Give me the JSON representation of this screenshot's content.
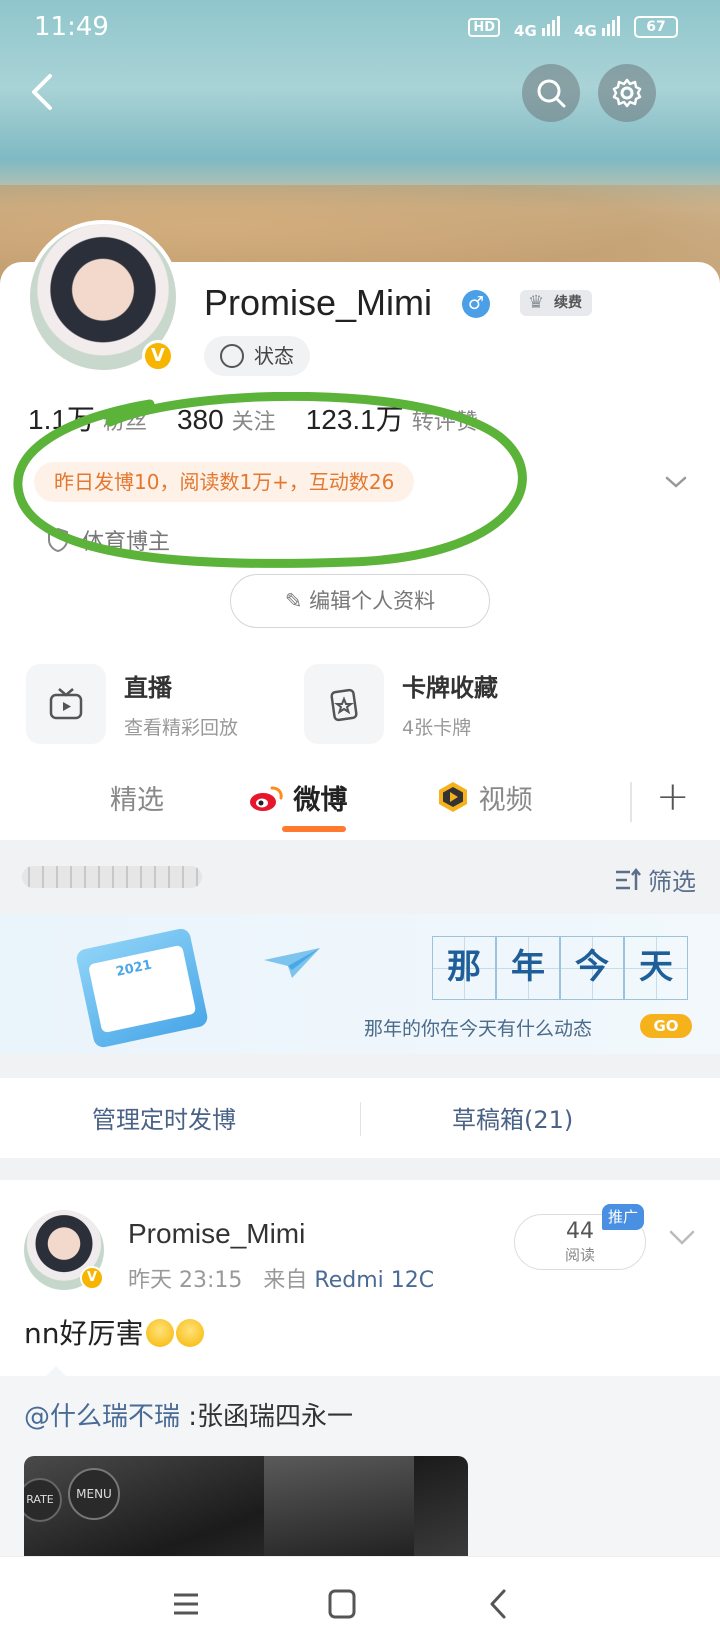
{
  "status_bar": {
    "time": "11:49",
    "network1": "4G",
    "network2": "4G",
    "hd": "HD",
    "battery": "67"
  },
  "profile": {
    "username": "Promise_Mimi",
    "gender_symbol": "♂",
    "vip_label": "续费",
    "verified_mark": "V",
    "status_label": "状态",
    "stats": [
      {
        "value": "1.1万",
        "label": "粉丝"
      },
      {
        "value": "380",
        "label": "关注"
      },
      {
        "value": "123.1万",
        "label": "转评赞"
      }
    ],
    "summary": "昨日发博10，阅读数1万+，互动数26",
    "tag": "体育博主",
    "edit_button": "编辑个人资料"
  },
  "features": [
    {
      "title": "直播",
      "subtitle": "查看精彩回放",
      "icon": "tv-icon"
    },
    {
      "title": "卡牌收藏",
      "subtitle": "4张卡牌",
      "icon": "card-icon"
    }
  ],
  "tabs": [
    {
      "label": "精选",
      "active": false
    },
    {
      "label": "微博",
      "active": true,
      "icon": "weibo-logo-icon"
    },
    {
      "label": "视频",
      "active": false,
      "icon": "video-play-icon"
    }
  ],
  "filter": {
    "label": "筛选"
  },
  "promo": {
    "chars": [
      "那",
      "年",
      "今",
      "天"
    ],
    "calendar_year": "2021",
    "subtitle": "那年的你在今天有什么动态",
    "go": "GO"
  },
  "manage": {
    "scheduled": "管理定时发博",
    "drafts": "草稿箱(21)"
  },
  "post": {
    "author": "Promise_Mimi",
    "time": "昨天 23:15",
    "from_label": "来自",
    "source": "Redmi 12C",
    "read_count": "44",
    "read_label": "阅读",
    "promote_label": "推广",
    "text": "nn好厉害",
    "verified_mark": "V",
    "repost_mention": "@什么瑞不瑞",
    "repost_text": " :张函瑞四永一",
    "image_labels": [
      "RATE",
      "MENU"
    ]
  },
  "colors": {
    "accent": "#ff7a2f",
    "summary_text": "#e4782f",
    "link": "#4a6b96",
    "verified": "#f7b500",
    "annotation_green": "#5cb33a"
  }
}
